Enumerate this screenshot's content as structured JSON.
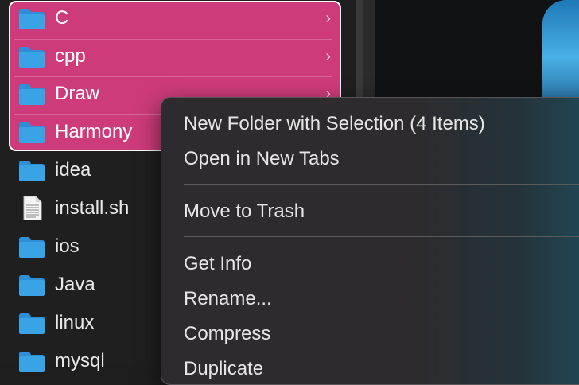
{
  "files": [
    {
      "name": "C",
      "type": "folder",
      "has_children": true,
      "selected": true
    },
    {
      "name": "cpp",
      "type": "folder",
      "has_children": true,
      "selected": true
    },
    {
      "name": "Draw",
      "type": "folder",
      "has_children": true,
      "selected": true
    },
    {
      "name": "Harmony",
      "type": "folder",
      "has_children": true,
      "selected": true
    },
    {
      "name": "idea",
      "type": "folder",
      "selected": false
    },
    {
      "name": "install.sh",
      "type": "document",
      "selected": false
    },
    {
      "name": "ios",
      "type": "folder",
      "selected": false
    },
    {
      "name": "Java",
      "type": "folder",
      "selected": false
    },
    {
      "name": "linux",
      "type": "folder",
      "selected": false
    },
    {
      "name": "mysql",
      "type": "folder",
      "selected": false
    }
  ],
  "chevron": "›",
  "context_menu": {
    "items": [
      {
        "label": "New Folder with Selection (4 Items)"
      },
      {
        "label": "Open in New Tabs"
      },
      {
        "label": "Move to Trash"
      },
      {
        "label": "Get Info"
      },
      {
        "label": "Rename..."
      },
      {
        "label": "Compress"
      },
      {
        "label": "Duplicate"
      }
    ]
  },
  "colors": {
    "selection": "#cd3b7a",
    "folder": "#3aa3e6"
  },
  "icons": {
    "folder": "folder-icon",
    "document": "document-icon",
    "chevron": "chevron-right-icon"
  }
}
